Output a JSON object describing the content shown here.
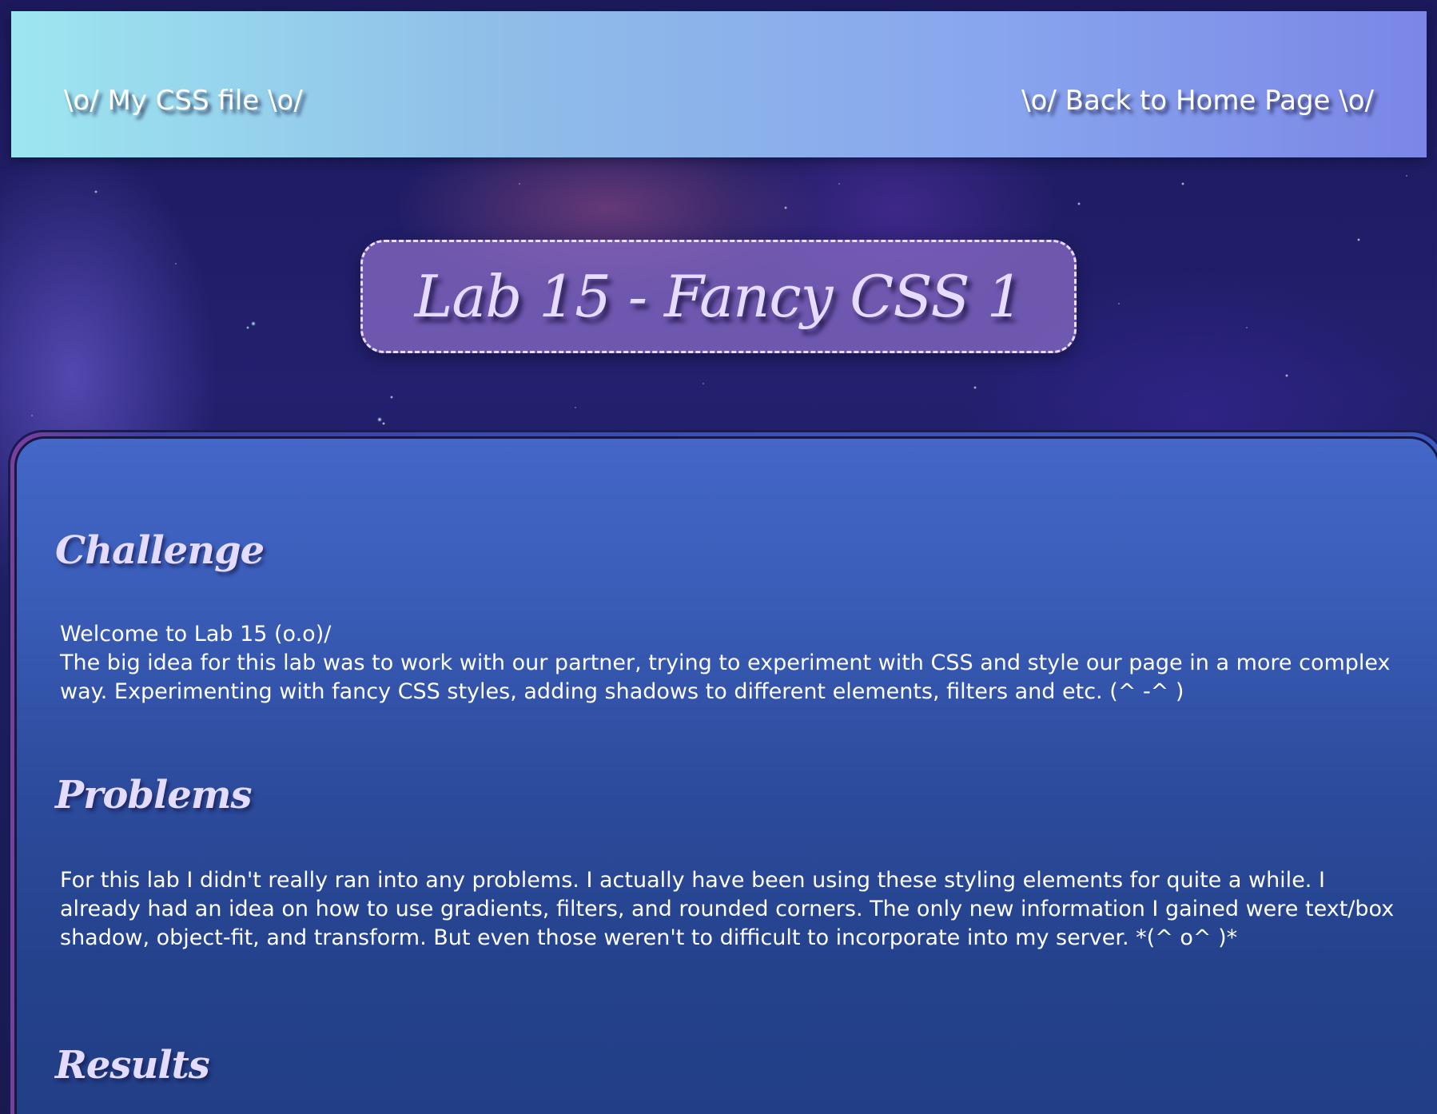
{
  "nav": {
    "css_link": "\\o/ My CSS file \\o/",
    "home_link": "\\o/ Back to Home Page \\o/"
  },
  "title": "Lab 15 - Fancy CSS 1",
  "sections": {
    "challenge": {
      "heading": "Challenge",
      "line1": "Welcome to Lab 15 (o.o)/",
      "line2": "The big idea for this lab was to work with our partner, trying to experiment with CSS and style our page in a more complex way. Experimenting with fancy CSS styles, adding shadows to different elements, filters and etc. (^ -^ )"
    },
    "problems": {
      "heading": "Problems",
      "text": "For this lab I didn't really ran into any problems. I actually have been using these styling elements for quite a while. I already had an idea on how to use gradients, filters, and rounded corners. The only new information I gained were text/box shadow, object-fit, and transform. But even those weren't to difficult to incorporate into my server. *(^ o^ )*"
    },
    "results": {
      "heading": "Results"
    }
  },
  "colors": {
    "nav_gradient_start": "#9de6f0",
    "nav_gradient_end": "#7b86e6",
    "title_box": "#8c6ec8",
    "heading_text": "#e4dcff",
    "panel_top": "#4467c8",
    "panel_bottom": "#213e85"
  }
}
